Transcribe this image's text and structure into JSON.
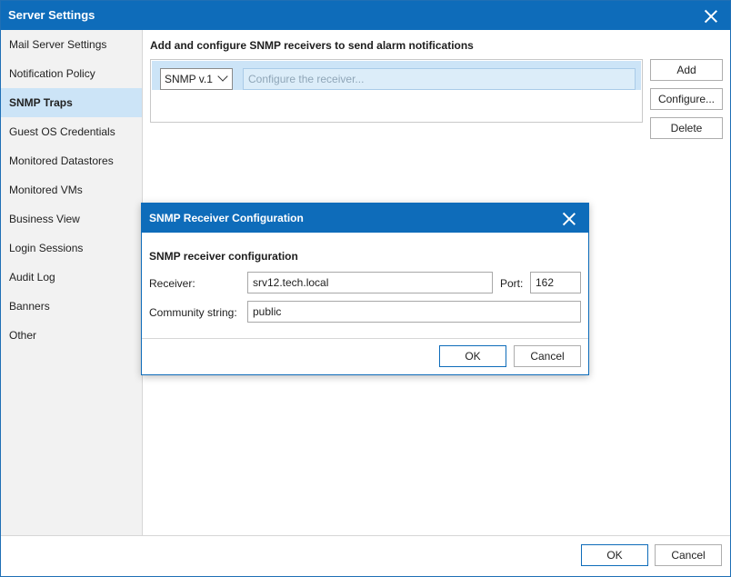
{
  "window": {
    "title": "Server Settings"
  },
  "sidebar": {
    "items": [
      {
        "label": "Mail Server Settings",
        "active": false
      },
      {
        "label": "Notification Policy",
        "active": false
      },
      {
        "label": "SNMP Traps",
        "active": true
      },
      {
        "label": "Guest OS Credentials",
        "active": false
      },
      {
        "label": "Monitored Datastores",
        "active": false
      },
      {
        "label": "Monitored VMs",
        "active": false
      },
      {
        "label": "Business View",
        "active": false
      },
      {
        "label": "Login Sessions",
        "active": false
      },
      {
        "label": "Audit Log",
        "active": false
      },
      {
        "label": "Banners",
        "active": false
      },
      {
        "label": "Other",
        "active": false
      }
    ]
  },
  "main": {
    "heading": "Add and configure SNMP receivers to send alarm notifications",
    "receiver_row": {
      "version": "SNMP v.1",
      "placeholder": "Configure the receiver..."
    },
    "buttons": {
      "add": "Add",
      "configure": "Configure...",
      "delete": "Delete"
    }
  },
  "footer": {
    "ok": "OK",
    "cancel": "Cancel"
  },
  "dialog": {
    "title": "SNMP Receiver Configuration",
    "subheading": "SNMP receiver configuration",
    "receiver_label": "Receiver:",
    "receiver_value": "srv12.tech.local",
    "port_label": "Port:",
    "port_value": "162",
    "community_label": "Community string:",
    "community_value": "public",
    "ok": "OK",
    "cancel": "Cancel"
  },
  "colors": {
    "accent": "#0e6cba",
    "selection": "#cce4f7"
  }
}
